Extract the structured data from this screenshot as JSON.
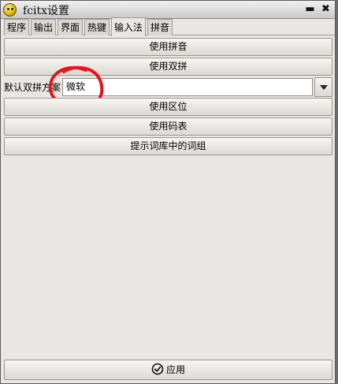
{
  "window": {
    "title": "fcitx设置",
    "minimize_glyph": "▬",
    "close_glyph": "✖"
  },
  "tabs": [
    {
      "label": "程序",
      "active": false
    },
    {
      "label": "输出",
      "active": false
    },
    {
      "label": "界面",
      "active": false
    },
    {
      "label": "热键",
      "active": false
    },
    {
      "label": "输入法",
      "active": true
    },
    {
      "label": "拼音",
      "active": false
    }
  ],
  "toggles": {
    "pinyin": "使用拼音",
    "shuangpin": "使用双拼",
    "quwei": "使用区位",
    "mabiao": "使用码表",
    "hint_phrases": "提示词库中的词组"
  },
  "shuangpin_scheme": {
    "label": "默认双拼方案",
    "value": "微软"
  },
  "apply": {
    "label": "应用",
    "icon": "check-circle-icon"
  },
  "annotation": {
    "color": "#e8141c"
  }
}
